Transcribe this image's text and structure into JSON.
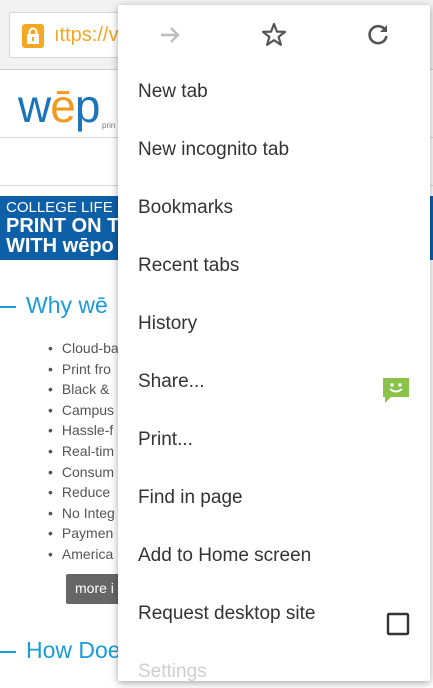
{
  "toolbar": {
    "url_text": "ıttps://v",
    "lock_color": "#f5a623"
  },
  "page": {
    "logo_text_a": "w",
    "logo_text_e": "ē",
    "logo_text_b": "p",
    "logo_sub": "prin",
    "banner": {
      "line1": "COLLEGE LIFE",
      "line2": "PRINT ON T",
      "line3": "WITH wēpo"
    },
    "section1_title": "Why wē",
    "section2_title": "How Doe",
    "bullets": [
      "Cloud-ba",
      "Print fro",
      "Black &",
      "Campus",
      "Hassle-f",
      "Real-tim",
      "Consum",
      "Reduce",
      "No Integ",
      "Paymen",
      "America"
    ],
    "more_button": "more i"
  },
  "menu": {
    "top_icons": [
      "forward-arrow-icon",
      "star-icon",
      "reload-icon"
    ],
    "items": [
      {
        "label": "New tab"
      },
      {
        "label": "New incognito tab"
      },
      {
        "label": "Bookmarks"
      },
      {
        "label": "Recent tabs"
      },
      {
        "label": "History"
      },
      {
        "label": "Share..."
      },
      {
        "label": "Print..."
      },
      {
        "label": "Find in page"
      },
      {
        "label": "Add to Home screen"
      },
      {
        "label": "Request desktop site"
      },
      {
        "label": "Settings"
      }
    ],
    "share_icon_color": "#8bc34a",
    "accent": "#1a9cd8"
  }
}
